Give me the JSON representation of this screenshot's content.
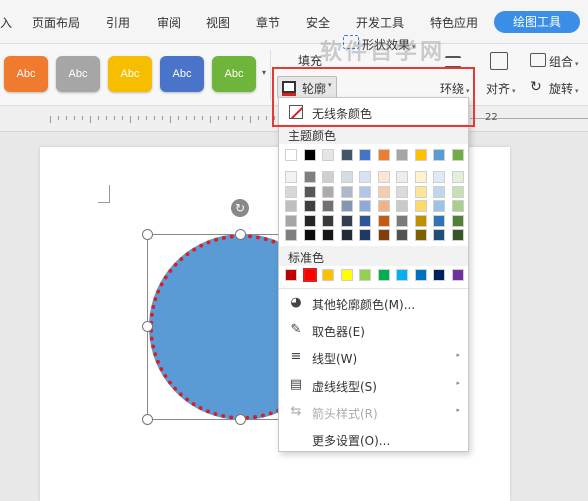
{
  "menubar": {
    "items": [
      "入",
      "页面布局",
      "引用",
      "审阅",
      "视图",
      "章节",
      "安全",
      "开发工具",
      "特色应用"
    ],
    "active_tab": "绘图工具"
  },
  "ribbon": {
    "style_swatches": [
      {
        "label": "Abc",
        "color": "#f07a2d"
      },
      {
        "label": "Abc",
        "color": "#a6a6a6"
      },
      {
        "label": "Abc",
        "color": "#f7be00"
      },
      {
        "label": "Abc",
        "color": "#4a74c9"
      },
      {
        "label": "Abc",
        "color": "#6fb53c"
      }
    ],
    "fill_label": "填充",
    "outline_label": "轮廓",
    "effect_label": "形状效果",
    "wrap_label": "环绕",
    "align_label": "对齐",
    "group_label": "组合",
    "rotate_label": "旋转",
    "watermark": "软件自学网"
  },
  "ruler": {
    "right_number": "22"
  },
  "dropdown": {
    "no_outline": "无线条颜色",
    "theme_colors_title": "主题颜色",
    "standard_colors_title": "标准色",
    "theme_top_row": [
      "#ffffff",
      "#000000",
      "#e7e6e6",
      "#44546a",
      "#4472c4",
      "#ed7d31",
      "#a5a5a5",
      "#ffc000",
      "#5b9bd5",
      "#70ad47"
    ],
    "theme_shades": [
      [
        "#f2f2f2",
        "#7f7f7f",
        "#d0cece",
        "#d6dce4",
        "#d9e2f3",
        "#fbe5d5",
        "#ededed",
        "#fff2cc",
        "#deebf6",
        "#e2efd9"
      ],
      [
        "#d8d8d8",
        "#595959",
        "#aeabab",
        "#adb9ca",
        "#b4c6e7",
        "#f7cbac",
        "#dbdbdb",
        "#fee599",
        "#bdd7ee",
        "#c5e0b3"
      ],
      [
        "#bfbfbf",
        "#3f3f3f",
        "#757070",
        "#8496b0",
        "#8eaadb",
        "#f4b183",
        "#c9c9c9",
        "#ffd965",
        "#9cc3e5",
        "#a8d08d"
      ],
      [
        "#a5a5a5",
        "#262626",
        "#3a3838",
        "#323f4f",
        "#2f5496",
        "#c55a11",
        "#7b7b7b",
        "#bf9000",
        "#2e75b5",
        "#538135"
      ],
      [
        "#7f7f7f",
        "#0c0c0c",
        "#171616",
        "#222a35",
        "#1f3864",
        "#833c0b",
        "#525252",
        "#7f6000",
        "#1e4e79",
        "#375623"
      ]
    ],
    "standard_colors": [
      "#c00000",
      "#ff0000",
      "#ffc000",
      "#ffff00",
      "#92d050",
      "#00b050",
      "#00b0f0",
      "#0070c0",
      "#002060",
      "#7030a0"
    ],
    "items": [
      {
        "label": "其他轮廓颜色(M)...",
        "icon": "palette-icon",
        "glyph": "◕",
        "submenu": false,
        "disabled": false
      },
      {
        "label": "取色器(E)",
        "icon": "eyedropper-icon",
        "glyph": "✎",
        "submenu": false,
        "disabled": false
      },
      {
        "label": "线型(W)",
        "icon": "line-weight-icon",
        "glyph": "≡",
        "submenu": true,
        "disabled": false
      },
      {
        "label": "虚线线型(S)",
        "icon": "dash-style-icon",
        "glyph": "▤",
        "submenu": true,
        "disabled": false
      },
      {
        "label": "箭头样式(R)",
        "icon": "arrow-style-icon",
        "glyph": "⇆",
        "submenu": true,
        "disabled": true
      },
      {
        "label": "更多设置(O)...",
        "icon": "",
        "glyph": "",
        "submenu": false,
        "disabled": false
      }
    ]
  },
  "colors": {
    "accent": "#3a8ee6",
    "shape_fill": "#5b9bd5",
    "shape_outline": "#d61f26",
    "highlight": "#e53935"
  }
}
